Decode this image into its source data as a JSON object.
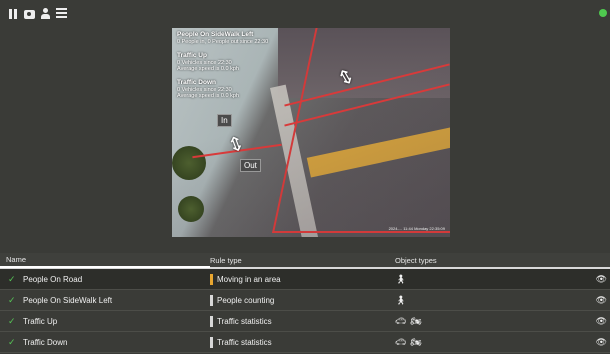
{
  "toolbar": {
    "icons": [
      "pause-icon",
      "camera-icon",
      "person-icon",
      "list-icon"
    ]
  },
  "video": {
    "overlay": [
      {
        "title": "People On SideWalk Left",
        "lines": [
          "0 People in, 0 People out since 22:30"
        ]
      },
      {
        "title": "Traffic Up",
        "lines": [
          "0 Vehicles since 22:30",
          "Average speed is 0.0 kph"
        ]
      },
      {
        "title": "Traffic Down",
        "lines": [
          "0 Vehicles since 22:30",
          "Average speed is 0.0 kph"
        ]
      }
    ],
    "in_label": "In",
    "out_label": "Out",
    "timestamp": "2024-... 11:44 Monday 22:35:09",
    "colors": {
      "zone": "#d23a3a",
      "marking": "#d7a43e"
    }
  },
  "table": {
    "headers": {
      "name": "Name",
      "rule_type": "Rule type",
      "object_types": "Object types"
    },
    "rows": [
      {
        "name": "People On Road",
        "rule_type": "Moving in an area",
        "rule_color": "#e8a630",
        "objects": [
          "person-icon"
        ],
        "enabled": true
      },
      {
        "name": "People On SideWalk Left",
        "rule_type": "People counting",
        "rule_color": "#d8d8d8",
        "objects": [
          "person-icon"
        ],
        "enabled": true
      },
      {
        "name": "Traffic Up",
        "rule_type": "Traffic statistics",
        "rule_color": "#d8d8d8",
        "objects": [
          "car-icon",
          "motorcycle-icon"
        ],
        "enabled": true
      },
      {
        "name": "Traffic Down",
        "rule_type": "Traffic statistics",
        "rule_color": "#d8d8d8",
        "objects": [
          "car-icon",
          "motorcycle-icon"
        ],
        "enabled": true
      }
    ]
  }
}
